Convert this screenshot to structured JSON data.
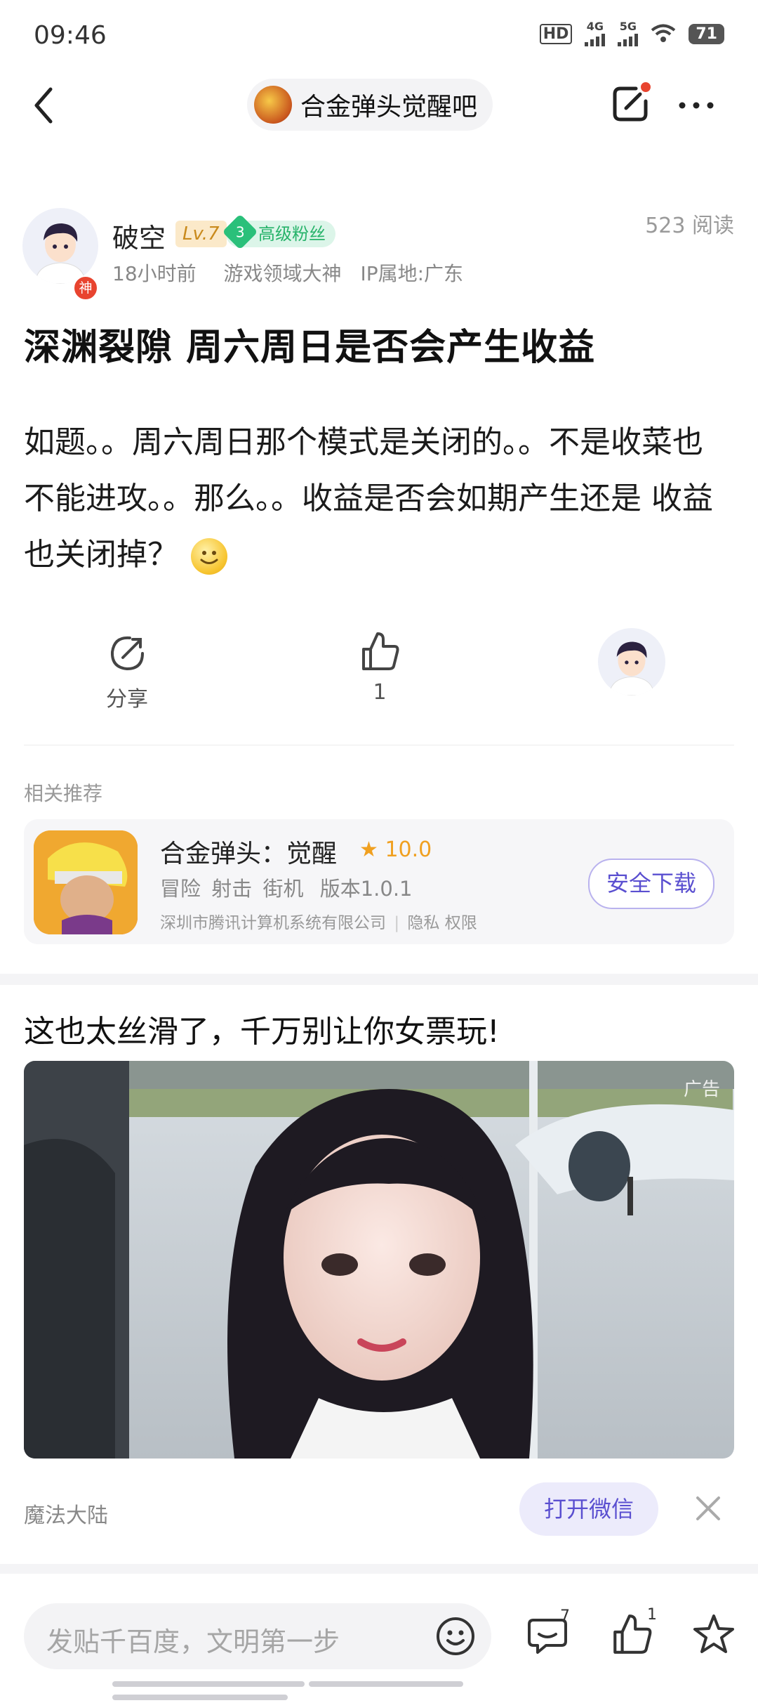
{
  "status_bar": {
    "time": "09:46",
    "hd_label": "HD",
    "net1": "4G",
    "net2": "5G",
    "battery": "71"
  },
  "nav": {
    "group_name": "合金弹头觉醒吧"
  },
  "author": {
    "name": "破空",
    "level": "Lv.7",
    "fan_level": "3",
    "fan_label": "高级粉丝",
    "avatar_badge": "神",
    "time": "18小时前",
    "title": "游戏领域大神",
    "ip": "IP属地:广东",
    "read_count": "523 阅读"
  },
  "post": {
    "title": "深渊裂隙 周六周日是否会产生收益",
    "body": "如题。。周六周日那个模式是关闭的。。不是收菜也不能进攻。。那么。。收益是否会如期产生还是 收益也关闭掉？"
  },
  "actions": {
    "share_label": "分享",
    "like_count": "1"
  },
  "related": {
    "section_title": "相关推荐",
    "app_name": "合金弹头：觉醒",
    "rating": "10.0",
    "tags": [
      "冒险",
      "射击",
      "街机"
    ],
    "version": "版本1.0.1",
    "corp": "深圳市腾讯计算机系统有限公司",
    "privacy": "隐私",
    "permissions": "权限",
    "download_label": "安全下载"
  },
  "ad": {
    "title": "这也太丝滑了，千万别让你女票玩!",
    "tag": "广告",
    "source": "魔法大陆",
    "open_label": "打开微信"
  },
  "bottom": {
    "placeholder": "发贴千百度，文明第一步",
    "comment_count": "7",
    "like_count": "1"
  },
  "colors": {
    "accent": "#5a4fd0",
    "fan_green": "#27b36a",
    "level_gold": "#c98a1c",
    "notify_red": "#e8442f"
  }
}
